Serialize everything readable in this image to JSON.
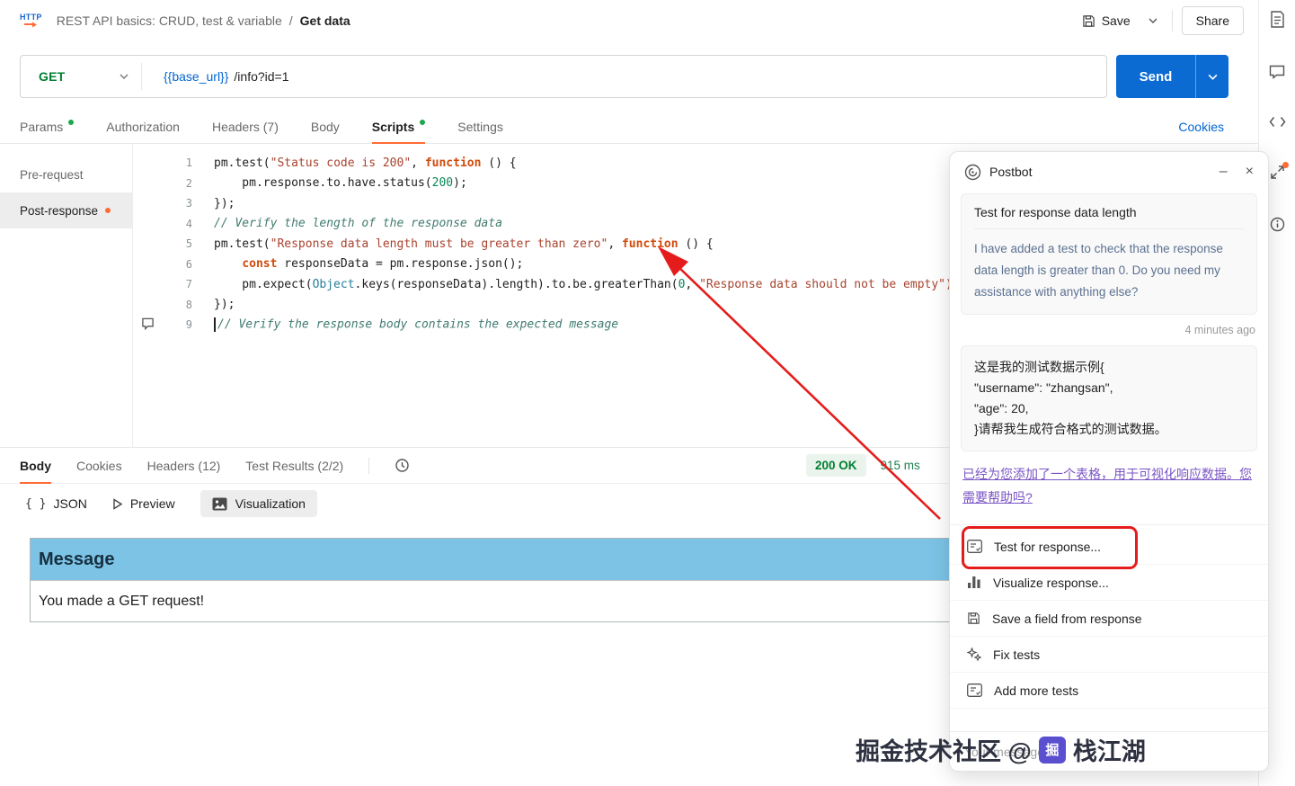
{
  "header": {
    "breadcrumb": {
      "collection": "REST API basics: CRUD, test & variable",
      "separator": "/",
      "current": "Get data"
    },
    "save_label": "Save",
    "share_label": "Share"
  },
  "request": {
    "method": "GET",
    "url_variable": "{{base_url}}",
    "url_path": "/info?id=1",
    "send_label": "Send"
  },
  "request_tabs": {
    "items": [
      {
        "label": "Params"
      },
      {
        "label": "Authorization"
      },
      {
        "label": "Headers (7)"
      },
      {
        "label": "Body"
      },
      {
        "label": "Scripts"
      },
      {
        "label": "Settings"
      }
    ],
    "cookies_link": "Cookies"
  },
  "scripts_panel": {
    "items": [
      {
        "label": "Pre-request"
      },
      {
        "label": "Post-response"
      }
    ]
  },
  "editor": {
    "lines": [
      {
        "num": 1,
        "tokens": [
          {
            "c": "plain",
            "t": "pm.test("
          },
          {
            "c": "string",
            "t": "\"Status code is 200\""
          },
          {
            "c": "plain",
            "t": ", "
          },
          {
            "c": "keyword",
            "t": "function"
          },
          {
            "c": "plain",
            "t": " () {"
          }
        ]
      },
      {
        "num": 2,
        "tokens": [
          {
            "c": "plain",
            "t": "    pm.response.to.have.status("
          },
          {
            "c": "number",
            "t": "200"
          },
          {
            "c": "plain",
            "t": ");"
          }
        ]
      },
      {
        "num": 3,
        "tokens": [
          {
            "c": "plain",
            "t": "});"
          }
        ]
      },
      {
        "num": 4,
        "tokens": [
          {
            "c": "comment",
            "t": "// Verify the length of the response data"
          }
        ]
      },
      {
        "num": 5,
        "tokens": [
          {
            "c": "plain",
            "t": "pm.test("
          },
          {
            "c": "string",
            "t": "\"Response data length must be greater than zero\""
          },
          {
            "c": "plain",
            "t": ", "
          },
          {
            "c": "keyword",
            "t": "function"
          },
          {
            "c": "plain",
            "t": " () {"
          }
        ]
      },
      {
        "num": 6,
        "tokens": [
          {
            "c": "plain",
            "t": "    "
          },
          {
            "c": "keyword",
            "t": "const"
          },
          {
            "c": "plain",
            "t": " responseData = pm.response.json();"
          }
        ]
      },
      {
        "num": 7,
        "tokens": [
          {
            "c": "plain",
            "t": "    pm.expect("
          },
          {
            "c": "type",
            "t": "Object"
          },
          {
            "c": "plain",
            "t": ".keys(responseData).length).to.be.greaterThan("
          },
          {
            "c": "number",
            "t": "0"
          },
          {
            "c": "plain",
            "t": ", "
          },
          {
            "c": "string",
            "t": "\"Response data should not be empty\");"
          }
        ]
      },
      {
        "num": 8,
        "tokens": [
          {
            "c": "plain",
            "t": "});"
          }
        ]
      },
      {
        "num": 9,
        "cursor": true,
        "tokens": [
          {
            "c": "comment",
            "t": "// Verify the response body contains the expected message"
          }
        ]
      }
    ]
  },
  "response": {
    "tabs": [
      {
        "label": "Body"
      },
      {
        "label": "Cookies"
      },
      {
        "label": "Headers (12)"
      },
      {
        "label": "Test Results (2/2)"
      }
    ],
    "status": "200 OK",
    "time": "915 ms",
    "views": {
      "json": "JSON",
      "preview": "Preview",
      "visualization": "Visualization"
    },
    "table": {
      "header": "Message",
      "row": "You made a GET request!"
    }
  },
  "postbot": {
    "title": "Postbot",
    "minimize": "–",
    "close": "×",
    "message": {
      "title": "Test for response data length",
      "body": "I have added a test to check that the response data length is greater than 0. Do you need my assistance with anything else?"
    },
    "timestamp": "4 minutes ago",
    "user_message": {
      "lines": [
        "这是我的测试数据示例{",
        "\"username\": \"zhangsan\",",
        "\"age\": 20,",
        "}请帮我生成符合格式的测试数据。"
      ]
    },
    "suggestion_link": "已经为您添加了一个表格，用于可视化响应数据。您需要帮助吗?",
    "menu": [
      {
        "label": "Test for response..."
      },
      {
        "label": "Visualize response..."
      },
      {
        "label": "Save a field from response"
      },
      {
        "label": "Fix tests"
      },
      {
        "label": "Add more tests"
      }
    ],
    "input_placeholder": "Your message..."
  },
  "watermark": {
    "prefix": "掘金技术社区 @",
    "name": "栈江湖"
  },
  "colors": {
    "accent_orange": "#ff6c37",
    "method_get_green": "#007f31",
    "send_blue": "#0b6bd2",
    "status_green": "#007f31",
    "link_blue": "#0265d2",
    "table_header_blue": "#7cc3e6",
    "annotation_red": "#e51c1c",
    "suggestion_purple": "#7a54c4"
  }
}
